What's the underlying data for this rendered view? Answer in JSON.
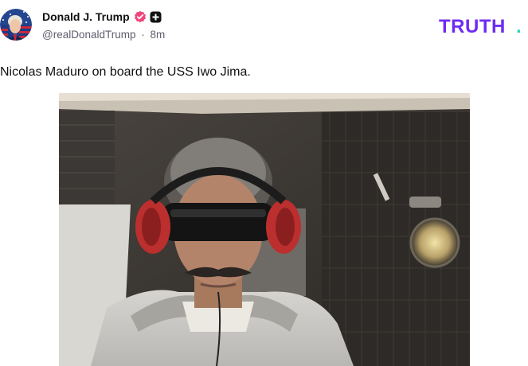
{
  "post": {
    "author": {
      "display_name": "Donald J. Trump",
      "handle": "@realDonaldTrump",
      "separator": "·",
      "timestamp": "8m",
      "verified_icon": "verified-badge-icon",
      "badge_icon": "plus-badge-icon",
      "avatar_icon": "profile-avatar"
    },
    "brand": {
      "logo_text": "TRUTH",
      "logo_dot": ".",
      "logo_color": "#6e2cf2",
      "dot_color": "#24d8b5"
    },
    "text": "Nicolas Maduro on board the USS Iwo Jima.",
    "media": {
      "type": "photo",
      "icon": "photo-attachment"
    }
  },
  "colors": {
    "text_primary": "#111111",
    "text_secondary": "#5e5e6e",
    "verified": "#f0457b",
    "badge": "#111111"
  }
}
